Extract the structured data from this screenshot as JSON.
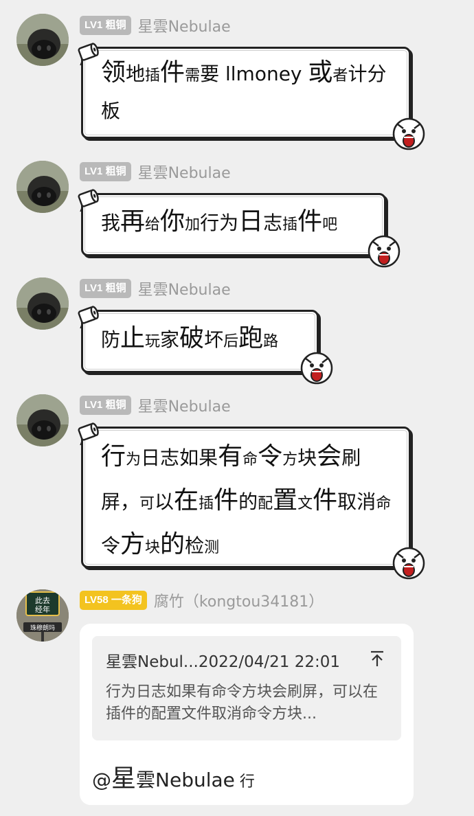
{
  "messages": [
    {
      "level": "LV1 粗铜",
      "nickname": "星雲Nebulae",
      "segments": [
        {
          "t": "领",
          "z": "l"
        },
        {
          "t": "地",
          "z": "m"
        },
        {
          "t": "插",
          "z": "s"
        },
        {
          "t": "件",
          "z": "l"
        },
        {
          "t": "需",
          "z": "s"
        },
        {
          "t": "要",
          "z": "m"
        },
        {
          "t": " llmoney ",
          "z": "m"
        },
        {
          "t": "或",
          "z": "l"
        },
        {
          "t": "者",
          "z": "s"
        },
        {
          "t": "计",
          "z": "m"
        },
        {
          "t": "分",
          "z": "m"
        },
        {
          "t": "板",
          "z": "m"
        }
      ]
    },
    {
      "level": "LV1 粗铜",
      "nickname": "星雲Nebulae",
      "segments": [
        {
          "t": "我",
          "z": "m"
        },
        {
          "t": "再",
          "z": "l"
        },
        {
          "t": "给",
          "z": "s"
        },
        {
          "t": "你",
          "z": "l"
        },
        {
          "t": "加",
          "z": "s"
        },
        {
          "t": "行",
          "z": "m"
        },
        {
          "t": "为",
          "z": "m"
        },
        {
          "t": "日",
          "z": "l"
        },
        {
          "t": "志",
          "z": "m"
        },
        {
          "t": "插",
          "z": "s"
        },
        {
          "t": "件",
          "z": "l"
        },
        {
          "t": "吧",
          "z": "s"
        }
      ]
    },
    {
      "level": "LV1 粗铜",
      "nickname": "星雲Nebulae",
      "segments": [
        {
          "t": "防",
          "z": "m"
        },
        {
          "t": "止",
          "z": "l"
        },
        {
          "t": "玩",
          "z": "s"
        },
        {
          "t": "家",
          "z": "m"
        },
        {
          "t": "破",
          "z": "l"
        },
        {
          "t": "坏",
          "z": "m"
        },
        {
          "t": "后",
          "z": "s"
        },
        {
          "t": "跑",
          "z": "l"
        },
        {
          "t": "路",
          "z": "s"
        }
      ]
    },
    {
      "level": "LV1 粗铜",
      "nickname": "星雲Nebulae",
      "segments": [
        {
          "t": "行",
          "z": "l"
        },
        {
          "t": "为",
          "z": "s"
        },
        {
          "t": "日",
          "z": "m"
        },
        {
          "t": "志",
          "z": "m"
        },
        {
          "t": "如",
          "z": "m"
        },
        {
          "t": "果",
          "z": "m"
        },
        {
          "t": "有",
          "z": "l"
        },
        {
          "t": "命",
          "z": "s"
        },
        {
          "t": "令",
          "z": "l"
        },
        {
          "t": "方",
          "z": "s"
        },
        {
          "t": "块",
          "z": "m"
        },
        {
          "t": "会",
          "z": "l"
        },
        {
          "t": "刷",
          "z": "m"
        },
        {
          "t": "屏，",
          "z": "m"
        },
        {
          "t": "可",
          "z": "s"
        },
        {
          "t": "以",
          "z": "m"
        },
        {
          "t": "在",
          "z": "l"
        },
        {
          "t": "插",
          "z": "s"
        },
        {
          "t": "件",
          "z": "l"
        },
        {
          "t": "的",
          "z": "m"
        },
        {
          "t": "配",
          "z": "s"
        },
        {
          "t": "置",
          "z": "l"
        },
        {
          "t": "文",
          "z": "s"
        },
        {
          "t": "件",
          "z": "l"
        },
        {
          "t": "取",
          "z": "m"
        },
        {
          "t": "消",
          "z": "m"
        },
        {
          "t": "命",
          "z": "s"
        },
        {
          "t": "令",
          "z": "m"
        },
        {
          "t": "方",
          "z": "l"
        },
        {
          "t": "块",
          "z": "s"
        },
        {
          "t": "的",
          "z": "l"
        },
        {
          "t": "检",
          "z": "m"
        },
        {
          "t": "测",
          "z": "s"
        }
      ]
    }
  ],
  "reply": {
    "level": "LV58 一条狗",
    "nickname": "腐竹（kongtou34181）",
    "avatar_text_top": "此去",
    "avatar_text_mid": "经年",
    "avatar_text_sign": "珠穆朗玛",
    "quote_header": "星雲Nebul...2022/04/21 22:01",
    "quote_body": "行为日志如果有命令方块会刷屏，可以在插件的配置文件取消命令方块...",
    "reply_segments": [
      {
        "t": "@",
        "z": "m"
      },
      {
        "t": "星",
        "z": "l"
      },
      {
        "t": "雲",
        "z": "m"
      },
      {
        "t": "Nebulae",
        "z": "m"
      },
      {
        "t": " 行",
        "z": "s"
      }
    ]
  },
  "icons": {
    "toilet_paper": "toilet-paper-icon",
    "screaming_face": "screaming-face-icon",
    "jump_to_original": "arrow-up-to-top-icon"
  },
  "colors": {
    "background": "#efefef",
    "level_grey": "#b9b9b9",
    "level_gold": "#f3c31f",
    "nickname": "#9a9a9a"
  }
}
